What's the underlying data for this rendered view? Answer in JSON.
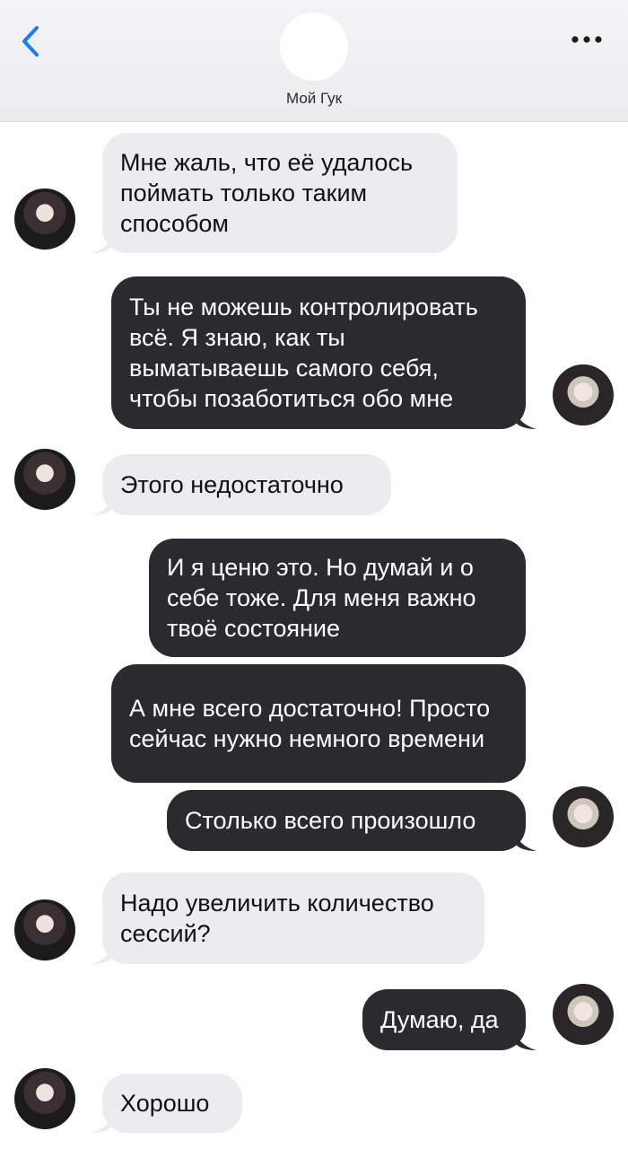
{
  "header": {
    "contact_name": "Мой Гук",
    "back_icon": "chevron-left-icon",
    "more_icon": "ellipsis-icon",
    "accent_color": "#1a7cf5"
  },
  "messages": [
    {
      "side": "in",
      "text": "Мне жаль, что её удалось поймать только таким способом"
    },
    {
      "side": "out",
      "text": "Ты не можешь контролировать всё. Я знаю, как ты выматываешь самого себя, чтобы позаботиться обо мне"
    },
    {
      "side": "in",
      "text": "Этого недостаточно"
    },
    {
      "side": "out",
      "text": "И я ценю это. Но думай и о себе тоже. Для меня важно твоё состояние"
    },
    {
      "side": "out",
      "text": "А мне всего достаточно! Просто сейчас нужно немного времени"
    },
    {
      "side": "out",
      "text": "Столько всего произошло"
    },
    {
      "side": "in",
      "text": "Надо увеличить количество сессий?"
    },
    {
      "side": "out",
      "text": "Думаю, да"
    },
    {
      "side": "in",
      "text": "Хорошо"
    }
  ]
}
